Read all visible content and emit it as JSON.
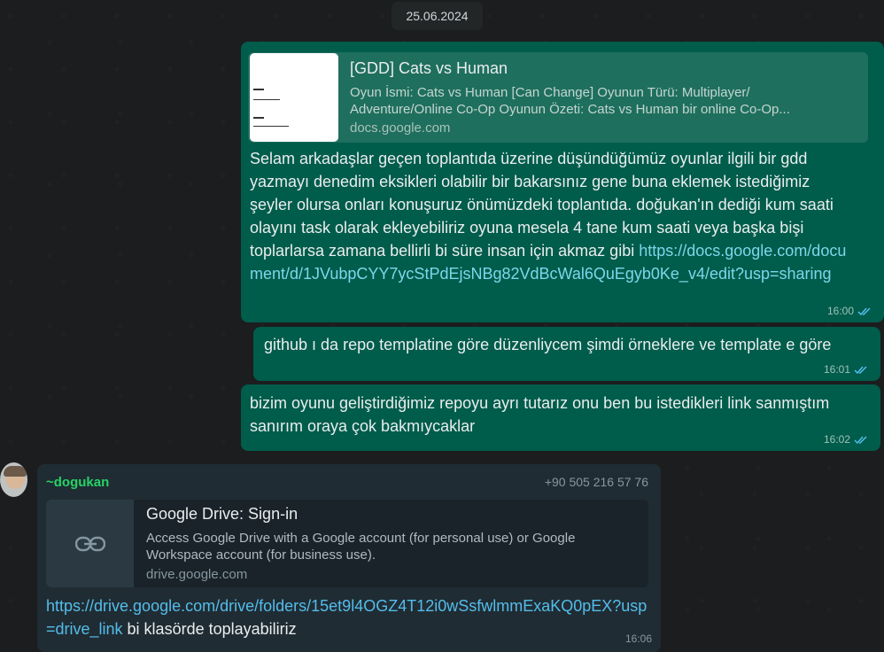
{
  "date_chip": "25.06.2024",
  "messages": {
    "m1": {
      "preview": {
        "title": "[GDD] Cats vs Human",
        "description": "Oyun İsmi:  Cats vs Human [Can Change]   Oyunun Türü: Multiplayer/ Adventure/Online Co-Op    Oyunun Özeti: Cats vs Human bir online Co-Op...",
        "domain": "docs.google.com"
      },
      "text": "Selam arkadaşlar geçen toplantıda üzerine düşündüğümüz oyunlar ilgili bir gdd yazmayı denedim eksikleri olabilir bir bakarsınız gene buna eklemek istediğimiz şeyler olursa onları konuşuruz önümüzdeki toplantıda. doğukan'ın dediği kum saati olayını task olarak ekleyebiliriz oyuna mesela 4 tane kum saati veya başka bişi toplarlarsa zamana bellirli bi süre insan için akmaz gibi ",
      "link": "https://docs.google.com/document/d/1JVubpCYY7ycStPdEjsNBg82VdBcWal6QuEgyb0Ke_v4/edit?usp=sharing",
      "time": "16:00"
    },
    "m2": {
      "text": "github ı da repo templatine göre düzenliycem şimdi örneklere ve template e göre",
      "time": "16:01"
    },
    "m3": {
      "text": "bizim oyunu geliştirdiğimiz repoyu ayrı tutarız onu ben bu istedikleri link sanmıştım sanırım oraya çok bakmıycaklar",
      "time": "16:02"
    },
    "m4": {
      "sender": "~dogukan",
      "phone": "+90 505 216 57 76",
      "preview": {
        "title": "Google Drive: Sign-in",
        "description": "Access Google Drive with a Google account (for personal use) or Google Workspace account (for business use).",
        "domain": "drive.google.com"
      },
      "link": "https://drive.google.com/drive/folders/15et9l4OGZ4T12i0wSsfwlmmExaKQ0pEX?usp=drive_link",
      "text": " bi klasörde toplayabiliriz",
      "time": "16:06"
    }
  },
  "icons": {
    "read_receipt": "double-check-icon",
    "link_placeholder": "link-icon",
    "avatar": "avatar"
  },
  "colors": {
    "outgoing_bubble": "#005c4b",
    "incoming_bubble": "#202c33",
    "link": "#53bdeb",
    "sender_name": "#25d366"
  }
}
